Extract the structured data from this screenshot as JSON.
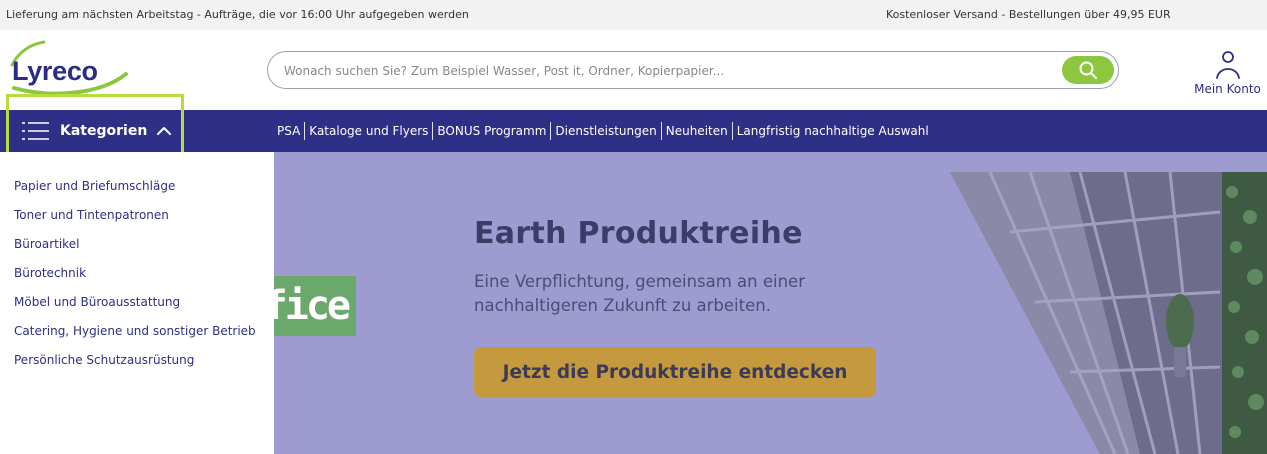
{
  "topbar": {
    "left_text": "Lieferung am nächsten Arbeitstag - Aufträge, die vor 16:00 Uhr aufgegeben werden",
    "right_text": "Kostenloser Versand - Bestellungen über 49,95 EUR"
  },
  "header": {
    "logo_text": "Lyreco",
    "search_placeholder": "Wonach suchen Sie? Zum Beispiel Wasser, Post it, Ordner, Kopierpapier...",
    "search_value": "",
    "account_label": "Mein Konto"
  },
  "nav": {
    "categories_label": "Kategorien",
    "links": [
      "PSA",
      "Kataloge und Flyers",
      "BONUS Programm",
      "Dienstleistungen",
      "Neuheiten",
      "Langfristig nachhaltige Auswahl"
    ]
  },
  "categories": [
    "Papier und Briefumschläge",
    "Toner und Tintenpatronen",
    "Büroartikel",
    "Bürotechnik",
    "Möbel und Büroausstattung",
    "Catering, Hygiene und sonstiger Betrieb",
    "Persönliche Schutzausrüstung"
  ],
  "banner": {
    "side_fragment": "fice",
    "title": "Earth Produktreihe",
    "subtitle": "Eine Verpflichtung, gemeinsam an einer nachhaltigeren Zukunft zu arbeiten.",
    "cta_label": "Jetzt die Produktreihe entdecken"
  },
  "colors": {
    "brand_navy": "#2e2f86",
    "brand_green": "#8dc63f",
    "highlight_box": "#b8dd3a",
    "banner_bg": "#9d9bd0",
    "cta_bg": "#c59a3f"
  },
  "icons": {
    "search": "search-icon",
    "account": "user-icon",
    "menu": "hamburger-icon",
    "chevron": "chevron-up-icon"
  }
}
